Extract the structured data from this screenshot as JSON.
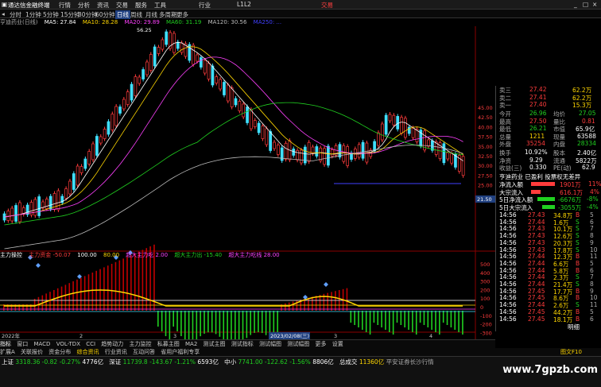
{
  "titlebar": {
    "app_name": "通达信金融终端",
    "menus": [
      "行情",
      "分析",
      "资讯",
      "交易",
      "服务",
      "工具",
      "行业",
      "L1L2"
    ],
    "deal": "交易",
    "window_icons": [
      "minimize-icon",
      "maximize-icon",
      "close-icon"
    ]
  },
  "periodbar": {
    "items": [
      "分时",
      "1分钟",
      "5分钟",
      "15分钟",
      "30分钟",
      "60分钟",
      "日线",
      "周线",
      "月线",
      "多周期",
      "更多"
    ],
    "active_index": 6
  },
  "ma_legend": {
    "stock": "亨迪药业(日线)",
    "items": [
      {
        "label": "MA5: 27.84",
        "color": "#ffffff"
      },
      {
        "label": "MA10: 28.28",
        "color": "#ffd700"
      },
      {
        "label": "MA20: 29.89",
        "color": "#ff40ff"
      },
      {
        "label": "MA60: 31.19",
        "color": "#20d020"
      },
      {
        "label": "MA120: 30.56",
        "color": "#bbbbbb"
      },
      {
        "label": "MA250: ...",
        "color": "#4040ff"
      }
    ]
  },
  "price_axis": [
    "45.00",
    "42.50",
    "40.00",
    "37.50",
    "35.00",
    "32.50",
    "30.00",
    "27.50",
    "25.00"
  ],
  "price_marker": "21.50",
  "high_label": "56.25",
  "indicator_legend": {
    "name": "主力操控",
    "items": [
      {
        "label": "主力资金 -50.07",
        "color": "#ff3c3c"
      },
      {
        "label": "100.00",
        "color": "#ffffff"
      },
      {
        "label": "80.00",
        "color": "#ffd700"
      },
      {
        "label": "超大主力吃 2.00",
        "color": "#ff40ff"
      },
      {
        "label": "超大主力出 -15.40",
        "color": "#20d020"
      },
      {
        "label": "超大主力吃线 28.00",
        "color": "#ff40ff"
      }
    ]
  },
  "indicator_axis": [
    "500",
    "400",
    "300",
    "200",
    "100",
    "0",
    "-100",
    "-200",
    "-300"
  ],
  "dates": [
    "2022年",
    "2",
    "3",
    "2023/02/08(三)",
    "3",
    "4"
  ],
  "quote": {
    "rows": [
      {
        "label": "卖三",
        "price": "27.42",
        "vol": "62.2万"
      },
      {
        "label": "卖二",
        "price": "27.41",
        "vol": "62.2万"
      },
      {
        "label": "卖一",
        "price": "27.40",
        "vol": "15.3万"
      }
    ],
    "today_open": "26.96",
    "avg": "27.05",
    "high": "27.50",
    "ratio": "0.81",
    "low": "26.21",
    "market_val": "65.9亿",
    "vol_total": "1211",
    "pe": "63588",
    "outer": "35254",
    "inner": "28334",
    "turnover": "10.92%",
    "share_cap": "2.40亿",
    "net_asset": "9.29",
    "float": "5822万",
    "eps": "0.330",
    "pe_ttm": "62.9",
    "notice": "亨迪药业 已盈利 投票权无差异",
    "flows": [
      {
        "label": "净流入额",
        "value": "1901万",
        "pct": "11%",
        "color": "#ff3c3c"
      },
      {
        "label": "大宗流入",
        "value": "616.1万",
        "pct": "4%",
        "color": "#ff3c3c"
      },
      {
        "label": "5日净流入额",
        "value": "-6676万",
        "pct": "-8%",
        "color": "#20d020"
      },
      {
        "label": "5日大宗流入",
        "value": "-3055万",
        "pct": "-4%",
        "color": "#20d020"
      }
    ],
    "ticks": [
      {
        "t": "14:56",
        "p": "27.43",
        "v": "34.8万",
        "d": "B"
      },
      {
        "t": "14:56",
        "p": "27.44",
        "v": "1.6万",
        "d": "S"
      },
      {
        "t": "14:56",
        "p": "27.43",
        "v": "10.1万",
        "d": "S"
      },
      {
        "t": "14:56",
        "p": "27.43",
        "v": "12.6万",
        "d": "S"
      },
      {
        "t": "14:56",
        "p": "27.43",
        "v": "20.3万",
        "d": "S"
      },
      {
        "t": "14:56",
        "p": "27.43",
        "v": "17.8万",
        "d": "S"
      },
      {
        "t": "14:56",
        "p": "27.44",
        "v": "12.3万",
        "d": "B"
      },
      {
        "t": "14:56",
        "p": "27.44",
        "v": "6.6万",
        "d": "B"
      },
      {
        "t": "14:56",
        "p": "27.44",
        "v": "5.8万",
        "d": "B"
      },
      {
        "t": "14:56",
        "p": "27.44",
        "v": "2.3万",
        "d": "S"
      },
      {
        "t": "14:56",
        "p": "27.44",
        "v": "21.4万",
        "d": "S"
      },
      {
        "t": "14:56",
        "p": "27.45",
        "v": "17.7万",
        "d": "B"
      },
      {
        "t": "14:56",
        "p": "27.45",
        "v": "8.6万",
        "d": "B"
      },
      {
        "t": "14:56",
        "p": "27.44",
        "v": "2.6万",
        "d": "S"
      },
      {
        "t": "14:56",
        "p": "27.45",
        "v": "44.2万",
        "d": "B"
      },
      {
        "t": "14:56",
        "p": "27.45",
        "v": "18.1万",
        "d": "B"
      }
    ],
    "bottom_tab": "明细"
  },
  "tabs": [
    "指标",
    "窗口",
    "MACD",
    "VOL-TDX",
    "CCI",
    "趋势动力",
    "主力监控",
    "私募主图",
    "MA2",
    "测试主图",
    "测试指标",
    "测试幅图",
    "测试幅图",
    "更多",
    "设置"
  ],
  "subtabs": [
    "扩展A",
    "关联报价",
    "资金分布",
    "综合资讯",
    "行业资讯",
    "互动问答",
    "省用户福利专享"
  ],
  "subtab_right": "图文F10",
  "status": {
    "sh_label": "上证",
    "sh_val": "3318.36",
    "sh_chg": "-0.82",
    "sh_pct": "-0.27%",
    "sh_amt": "4776亿",
    "sz_label": "深证",
    "sz_val": "11739.8",
    "sz_chg": "-143.67",
    "sz_pct": "-1.21%",
    "sz_amt": "6593亿",
    "zx_label": "中小",
    "zx_val": "7741.00",
    "zx_chg": "-122.62",
    "zx_pct": "-1.56%",
    "zx_amt": "8806亿",
    "total_label": "总成交",
    "total_val": "11360亿",
    "news": "平安证券长沙行情"
  },
  "watermark": "www.7gpzb.com"
}
